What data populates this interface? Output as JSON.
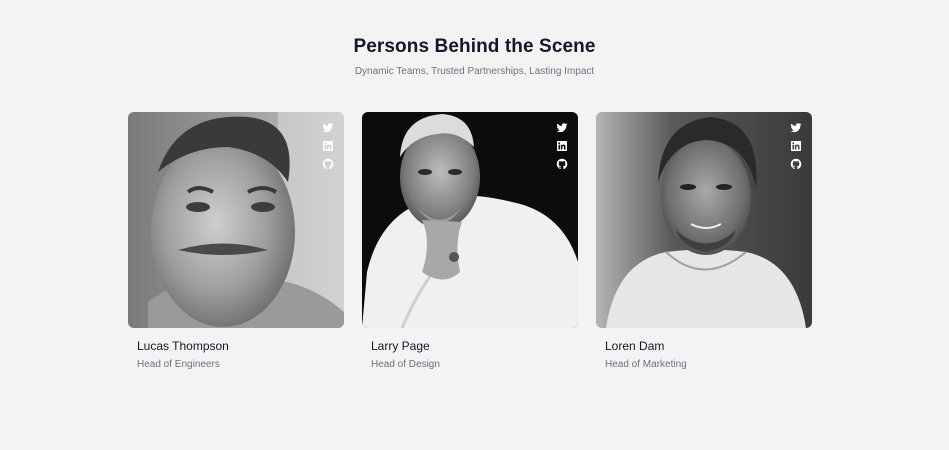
{
  "header": {
    "title": "Persons Behind the Scene",
    "subtitle": "Dynamic Teams, Trusted Partnerships, Lasting Impact"
  },
  "team": [
    {
      "name": "Lucas Thompson",
      "role": "Head of Engineers",
      "social": [
        "twitter-icon",
        "linkedin-icon",
        "github-icon"
      ]
    },
    {
      "name": "Larry Page",
      "role": "Head of Design",
      "social": [
        "twitter-icon",
        "linkedin-icon",
        "github-icon"
      ]
    },
    {
      "name": "Loren Dam",
      "role": "Head of Marketing",
      "social": [
        "twitter-icon",
        "linkedin-icon",
        "github-icon"
      ]
    }
  ],
  "colors": {
    "background": "#f3f3f3",
    "title": "#111827",
    "muted": "#6b7280"
  }
}
